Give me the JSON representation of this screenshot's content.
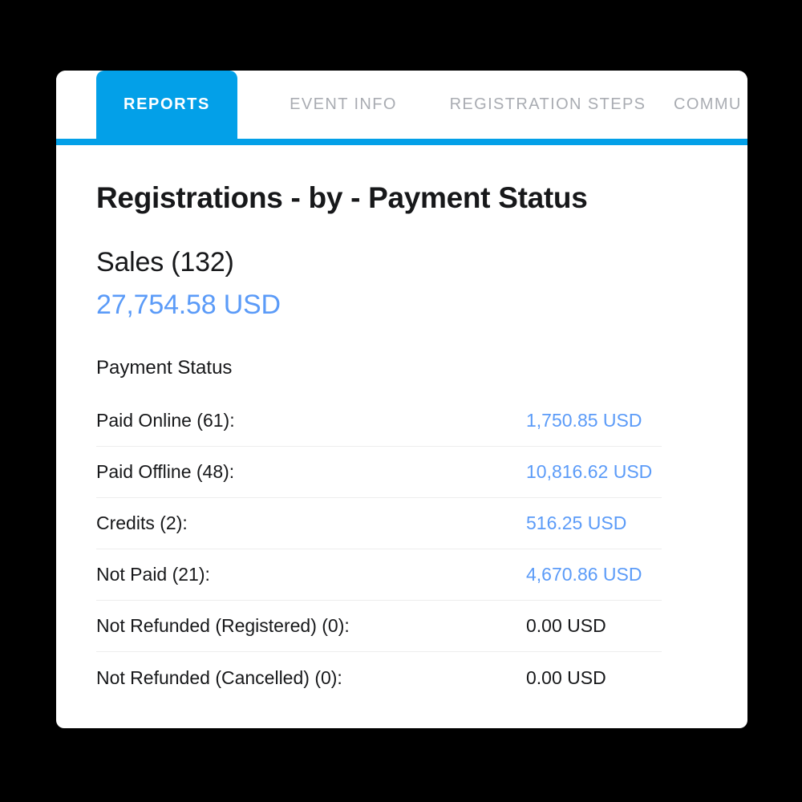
{
  "tabs": [
    {
      "id": "reports",
      "label": "REPORTS",
      "active": true
    },
    {
      "id": "eventinfo",
      "label": "EVENT INFO",
      "active": false
    },
    {
      "id": "regsteps",
      "label": "REGISTRATION STEPS",
      "active": false
    },
    {
      "id": "community",
      "label": "COMMU",
      "active": false
    }
  ],
  "page": {
    "title": "Registrations - by - Payment Status",
    "sales_heading": "Sales (132)",
    "sales_amount": "27,754.58 USD",
    "section_label": "Payment Status"
  },
  "status_rows": [
    {
      "label": "Paid Online (61):",
      "value": "1,750.85 USD",
      "zero": false
    },
    {
      "label": "Paid Offline (48):",
      "value": "10,816.62 USD",
      "zero": false
    },
    {
      "label": "Credits (2):",
      "value": "516.25 USD",
      "zero": false
    },
    {
      "label": "Not Paid (21):",
      "value": "4,670.86 USD",
      "zero": false
    },
    {
      "label": "Not Refunded (Registered) (0):",
      "value": "0.00 USD",
      "zero": true
    },
    {
      "label": "Not Refunded (Cancelled) (0):",
      "value": "0.00 USD",
      "zero": true
    }
  ],
  "colors": {
    "tab_active_blue": "#03a0e8",
    "value_blue": "#5b9bf8",
    "tab_inactive_gray": "#a9acb2",
    "text_dark": "#17181a",
    "divider": "#ededed",
    "backdrop": "#000000",
    "card": "#ffffff"
  }
}
